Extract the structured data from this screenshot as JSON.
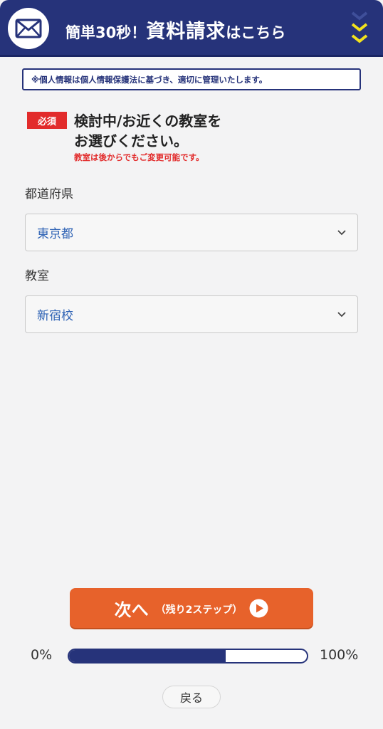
{
  "header": {
    "title_prefix": "簡単30秒！",
    "title_main": "資料請求",
    "title_suffix": "はこちら",
    "accent_color": "#26337a",
    "chevron_color": "#f2e21c"
  },
  "privacy_notice": "※個人情報は個人情報保護法に基づき、適切に管理いたします。",
  "question": {
    "required_badge": "必須",
    "line1": "検討中/お近くの教室を",
    "line2": "お選びください。",
    "note": "教室は後からでもご変更可能です。"
  },
  "fields": {
    "prefecture": {
      "label": "都道府県",
      "value": "東京都"
    },
    "classroom": {
      "label": "教室",
      "value": "新宿校"
    }
  },
  "next_button": {
    "label": "次へ",
    "sub_label": "（残り2ステップ）",
    "color": "#e7622b"
  },
  "progress": {
    "start_label": "0%",
    "end_label": "100%",
    "fraction": 0.66
  },
  "back_button": {
    "label": "戻る"
  }
}
